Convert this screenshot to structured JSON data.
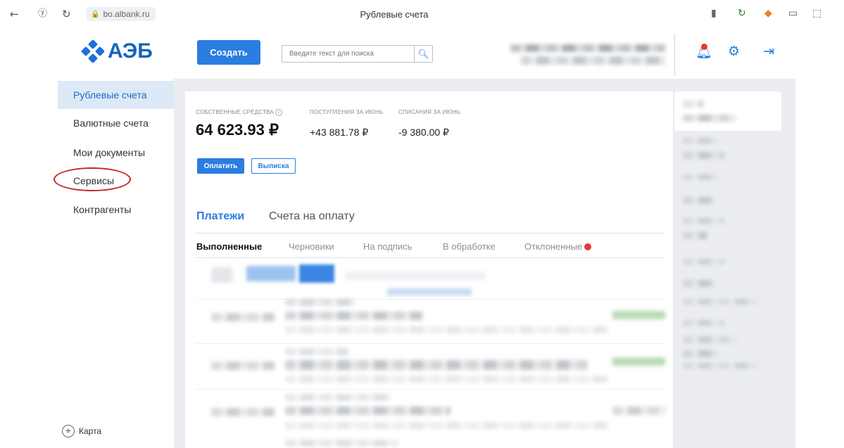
{
  "browser": {
    "back_icon": "arrow-left-icon",
    "yandex_icon": "yandex-icon",
    "reload_icon": "reload-icon",
    "url": "bo.albank.ru",
    "page_title": "Рублевые счета"
  },
  "header": {
    "logo_text": "АЭБ",
    "create_label": "Создать",
    "search_placeholder": "Введите текст для поиска",
    "icons": [
      "bell-icon",
      "gear-icon",
      "logout-icon"
    ]
  },
  "sidebar": {
    "items": [
      {
        "label": "Рублевые счета",
        "active": true
      },
      {
        "label": "Валютные счета",
        "active": false
      },
      {
        "label": "Мои документы",
        "active": false
      },
      {
        "label": "Сервисы",
        "active": false
      },
      {
        "label": "Контрагенты",
        "active": false
      }
    ],
    "card_label": "Карта"
  },
  "summary": {
    "own_funds_label": "СОБСТВЕННЫЕ СРЕДСТВА",
    "inflow_label": "ПОСТУПЛЕНИЯ ЗА ИЮНЬ",
    "outflow_label": "СПИСАНИЯ ЗА ИЮНЬ",
    "balance": "64 623.93 ₽",
    "inflow": "+43 881.78 ₽",
    "outflow": "-9 380.00 ₽",
    "pay_label": "Оплатить",
    "statement_label": "Выписка"
  },
  "tabs": {
    "primary": [
      "Платежи",
      "Счета на оплату"
    ],
    "secondary": [
      "Выполненные",
      "Черновики",
      "На подпись",
      "В обработке",
      "Отклоненные"
    ]
  },
  "colors": {
    "accent": "#2a7de1",
    "active_bg": "#dde9f6",
    "badge": "#e53935",
    "highlight_circle": "#c62828"
  }
}
